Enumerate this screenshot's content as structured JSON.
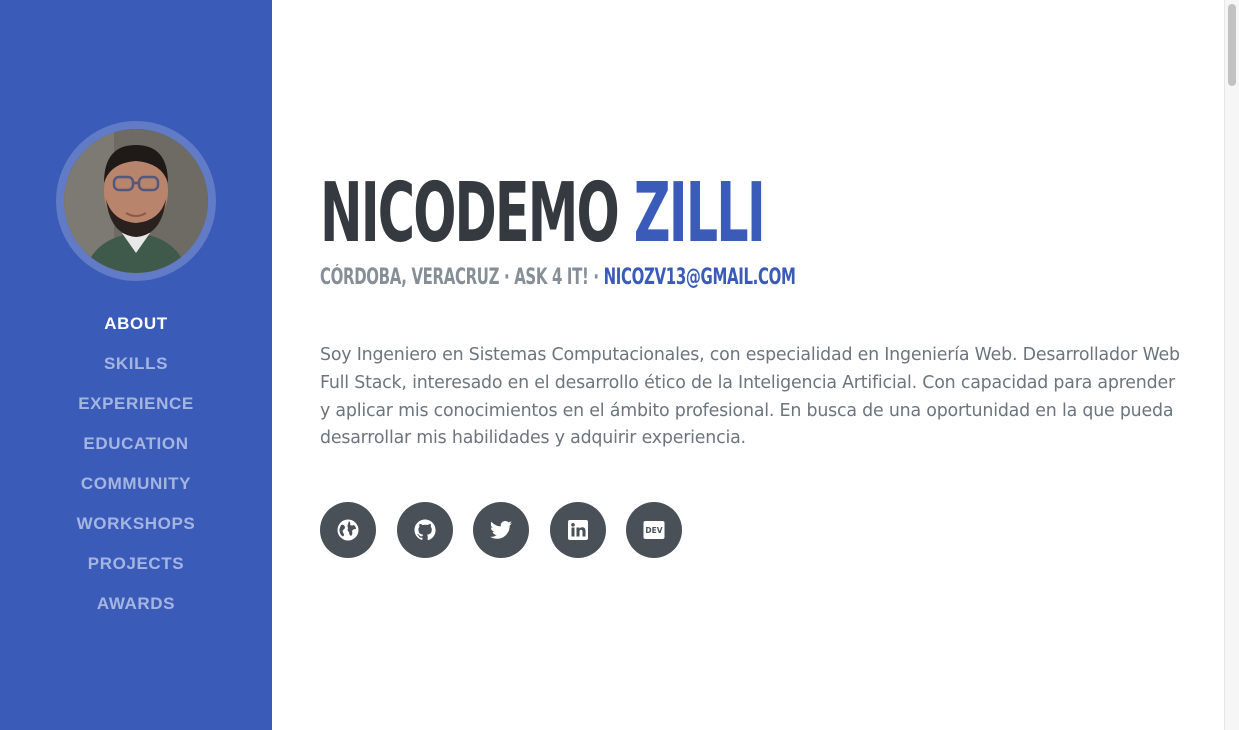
{
  "profile": {
    "first_name": "NICODEMO",
    "last_name": "ZILLI",
    "location": "CÓRDOBA, VERACRUZ · ASK 4 IT! ·",
    "email": "NICOZV13@GMAIL.COM",
    "bio": "Soy Ingeniero en Sistemas Computacionales, con especialidad en Ingeniería Web. Desarrollador Web Full Stack, interesado en el desarrollo ético de la Inteligencia Artificial. Con capacidad para aprender y aplicar mis conocimientos en el ámbito profesional. En busca de una oportunidad en la que pueda desarrollar mis habilidades y adquirir experiencia."
  },
  "nav": {
    "items": [
      {
        "label": "ABOUT",
        "active": true
      },
      {
        "label": "SKILLS",
        "active": false
      },
      {
        "label": "EXPERIENCE",
        "active": false
      },
      {
        "label": "EDUCATION",
        "active": false
      },
      {
        "label": "COMMUNITY",
        "active": false
      },
      {
        "label": "WORKSHOPS",
        "active": false
      },
      {
        "label": "PROJECTS",
        "active": false
      },
      {
        "label": "AWARDS",
        "active": false
      }
    ]
  },
  "social": {
    "icons": [
      "globe-icon",
      "github-icon",
      "twitter-icon",
      "linkedin-icon",
      "dev-icon"
    ],
    "dev_badge": "DEV"
  },
  "colors": {
    "primary": "#3a5bb8",
    "heading": "#343a40",
    "muted": "#868e96",
    "social_bg": "#495057"
  }
}
